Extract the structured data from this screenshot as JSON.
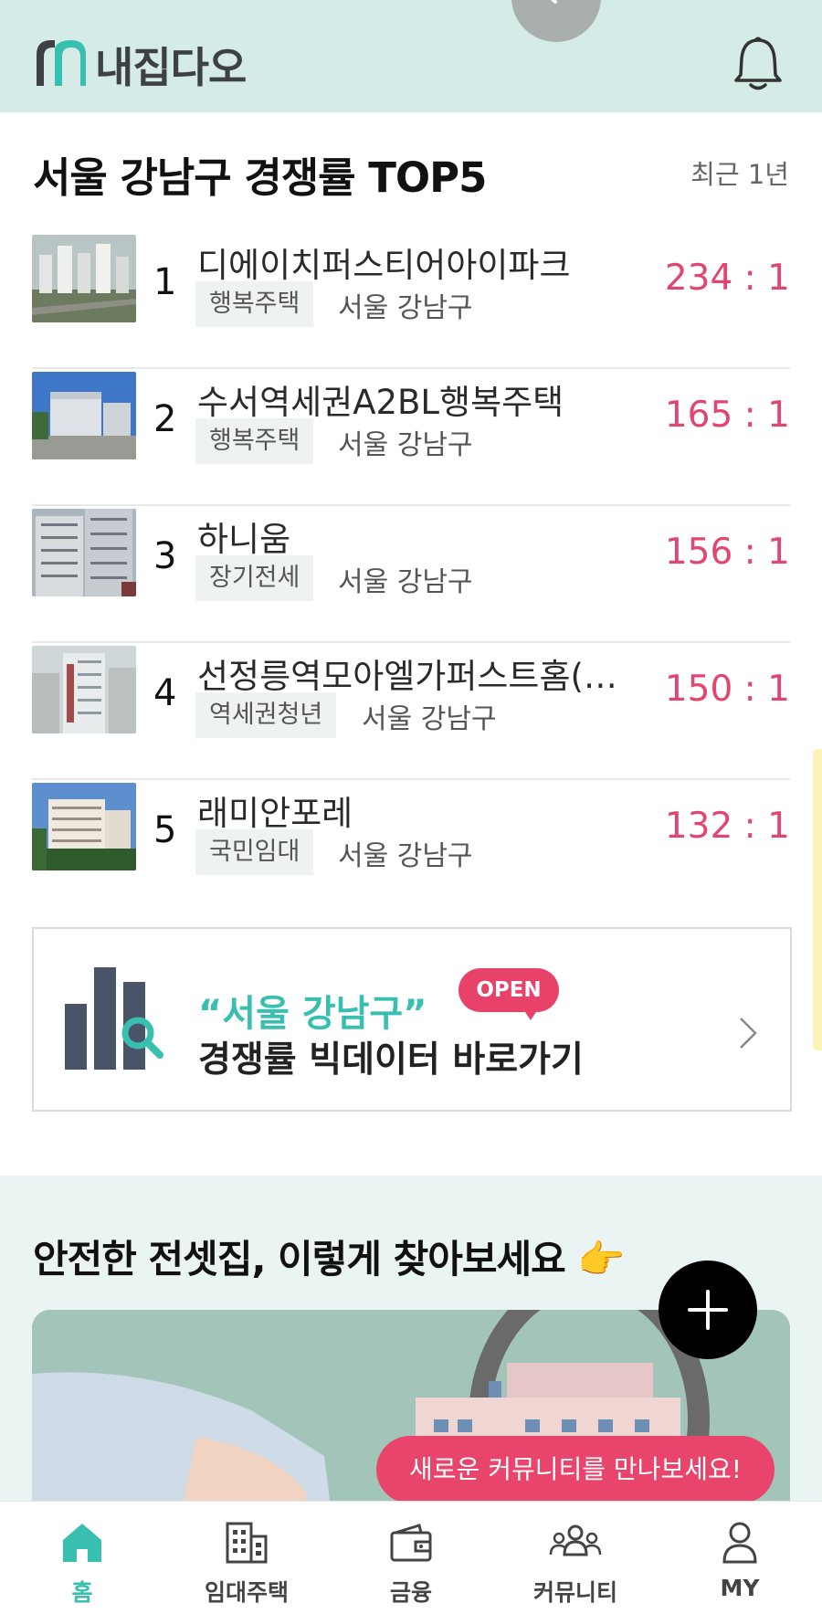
{
  "app": {
    "logo_text": "내집다오"
  },
  "colors": {
    "accent_teal": "#38bfb0",
    "accent_pink": "#e2456e",
    "header_bg": "#d5ebe7"
  },
  "ranking": {
    "title": "서울 강남구 경쟁률 TOP5",
    "period": "최근 1년",
    "items": [
      {
        "rank": "1",
        "name": "디에이치퍼스티어아이파크",
        "tag": "행복주택",
        "region": "서울 강남구",
        "ratio": "234 : 1"
      },
      {
        "rank": "2",
        "name": "수서역세권A2BL행복주택",
        "tag": "행복주택",
        "region": "서울 강남구",
        "ratio": "165 : 1"
      },
      {
        "rank": "3",
        "name": "하니움",
        "tag": "장기전세",
        "region": "서울 강남구",
        "ratio": "156 : 1"
      },
      {
        "rank": "4",
        "name": "선정릉역모아엘가퍼스트홈(…",
        "tag": "역세권청년",
        "region": "서울 강남구",
        "ratio": "150 : 1"
      },
      {
        "rank": "5",
        "name": "래미안포레",
        "tag": "국민임대",
        "region": "서울 강남구",
        "ratio": "132 : 1"
      }
    ]
  },
  "bigdata": {
    "line1": "“서울 강남구”",
    "line2": "경쟁률 빅데이터 바로가기",
    "badge": "OPEN"
  },
  "safe_section": {
    "title": "안전한 전셋집, 이렇게 찾아보세요 👉"
  },
  "community_bubble": "새로운 커뮤니티를 만나보세요!",
  "tabs": [
    {
      "label": "홈",
      "icon": "home-icon"
    },
    {
      "label": "임대주택",
      "icon": "building-icon"
    },
    {
      "label": "금융",
      "icon": "wallet-icon"
    },
    {
      "label": "커뮤니티",
      "icon": "people-icon"
    },
    {
      "label": "MY",
      "icon": "person-icon"
    }
  ]
}
